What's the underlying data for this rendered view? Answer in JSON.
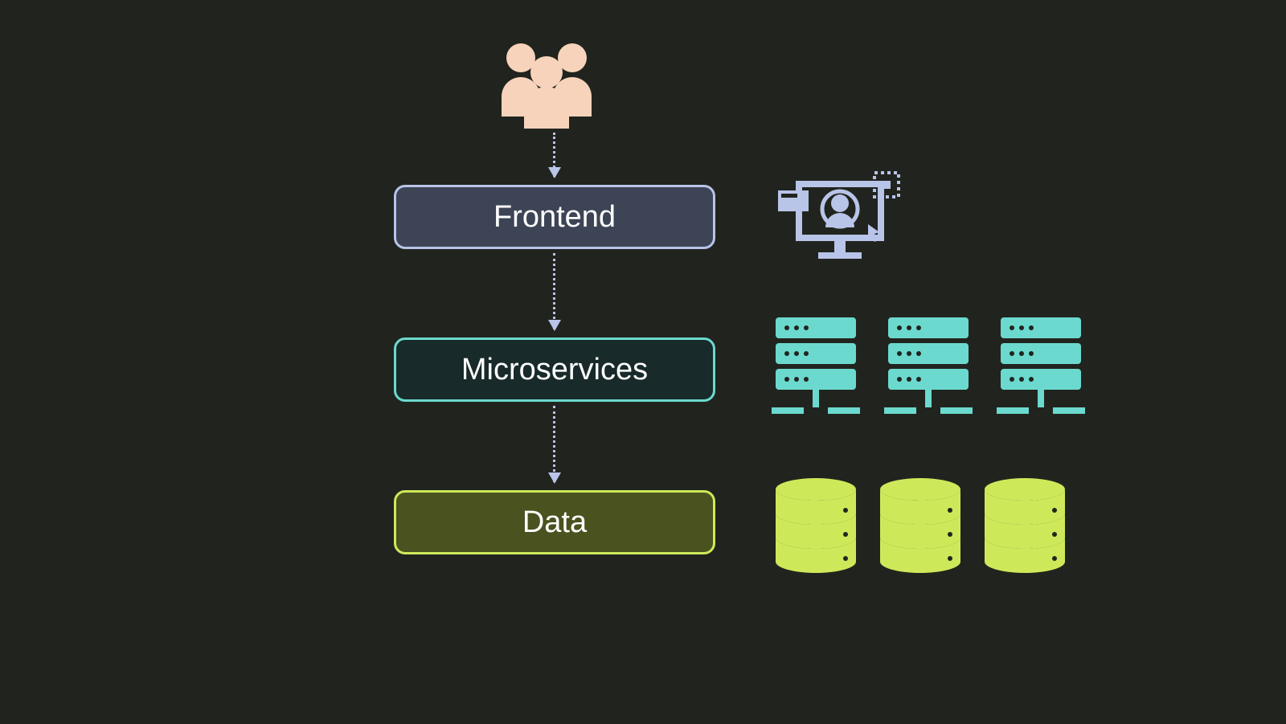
{
  "layers": {
    "frontend": {
      "label": "Frontend",
      "border": "#b8c4e8",
      "fill": "#3d4456"
    },
    "microservices": {
      "label": "Microservices",
      "border": "#6cd9ce",
      "fill": "#182a29"
    },
    "data": {
      "label": "Data",
      "border": "#cde95a",
      "fill": "#4a521f"
    }
  },
  "colors": {
    "users": "#f8d3bb",
    "ui": "#b8c4e8",
    "server": "#6cd9ce",
    "db": "#cde95a",
    "bg": "#21241e"
  }
}
